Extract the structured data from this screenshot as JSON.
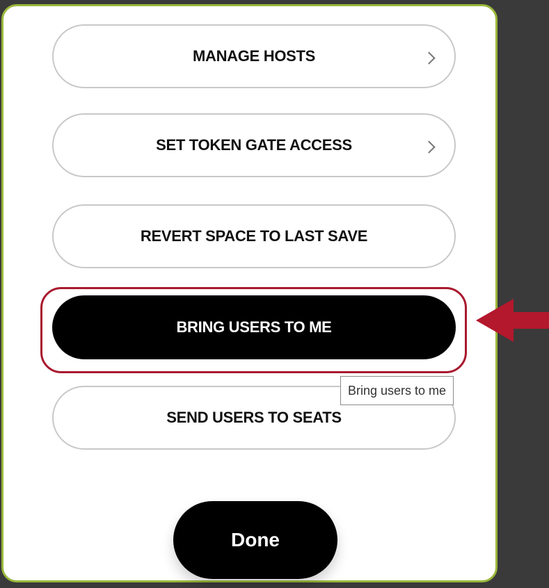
{
  "menu": {
    "items": [
      {
        "label": "MANAGE HOSTS",
        "has_chevron": true
      },
      {
        "label": "SET TOKEN GATE ACCESS",
        "has_chevron": true
      },
      {
        "label": "REVERT SPACE TO LAST SAVE",
        "has_chevron": false
      },
      {
        "label": "BRING USERS TO ME",
        "has_chevron": false,
        "active": true
      },
      {
        "label": "SEND USERS TO SEATS",
        "has_chevron": false
      }
    ]
  },
  "tooltip": {
    "text": "Bring users to me"
  },
  "footer": {
    "done_label": "Done"
  },
  "colors": {
    "panel_border": "#9bb83a",
    "highlight": "#a8192e",
    "arrow": "#b4182c",
    "background": "#3a3a3a"
  },
  "icons": {
    "chevron": "chevron-right-icon",
    "annotation": "left-arrow-icon"
  }
}
